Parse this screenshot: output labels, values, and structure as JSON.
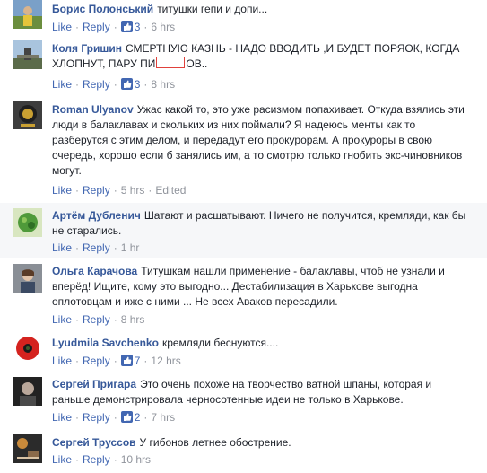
{
  "actions": {
    "like": "Like",
    "reply": "Reply",
    "separator": "·"
  },
  "colors": {
    "link": "#4267b2",
    "author": "#365899",
    "meta": "#90949c",
    "redaction": "#e0413b"
  },
  "comments": [
    {
      "author": "Борис Полонський",
      "text": "титушки гепи и допи...",
      "likes": "3",
      "time": "6 hrs",
      "avatar": "avatar-photo-1"
    },
    {
      "author": "Коля Гришин",
      "text_before": "СМЕРТНУЮ КАЗНЬ - НАДО ВВОДИТЬ ,И БУДЕТ ПОРЯОК, КОГДА ХЛОПНУТ, ПАРУ ПИ",
      "text_after": "ОВ..",
      "likes": "3",
      "time": "8 hrs",
      "avatar": "avatar-photo-2"
    },
    {
      "author": "Roman Ulyanov",
      "text": "Ужас какой то, это уже расизмом попахивает. Откуда взялись эти люди в балаклавах и скольких из них поймали? Я надеюсь менты как то разберутся с этим делом, и передадут его прокурорам. А прокуроры в свою очередь, хорошо если б занялись им, а то смотрю только гнобить экс-чиновников могут.",
      "time": "5 hrs",
      "edited": "Edited",
      "avatar": "avatar-photo-3"
    },
    {
      "author": "Артём Дубленич",
      "text": "Шатают и расшатывают. Ничего не получится, кремляди, как бы не старались.",
      "time": "1 hr",
      "avatar": "avatar-photo-4"
    },
    {
      "author": "Ольга Карачова",
      "text": "Титушкам нашли применение - балаклавы, чтоб не узнали и вперёд! Ищите, кому это выгодно... Дестабилизация в Харькове выгодна оплотовцам и иже с ними ... Не всех Аваков пересадили.",
      "time": "8 hrs",
      "avatar": "avatar-photo-5"
    },
    {
      "author": "Lyudmila Savchenko",
      "text": "кремляди беснуются....",
      "likes": "7",
      "time": "12 hrs",
      "avatar": "avatar-poppy"
    },
    {
      "author": "Сергей Пригара",
      "text": "Это очень похоже на творчество ватной шпаны, которая и раньше демонстрировала черносотенные идеи не только в Харькове.",
      "likes": "2",
      "time": "7 hrs",
      "avatar": "avatar-photo-7"
    },
    {
      "author": "Сергей Труссов",
      "text": "У гибонов летнее обострение.",
      "time": "10 hrs",
      "avatar": "avatar-photo-8"
    }
  ]
}
